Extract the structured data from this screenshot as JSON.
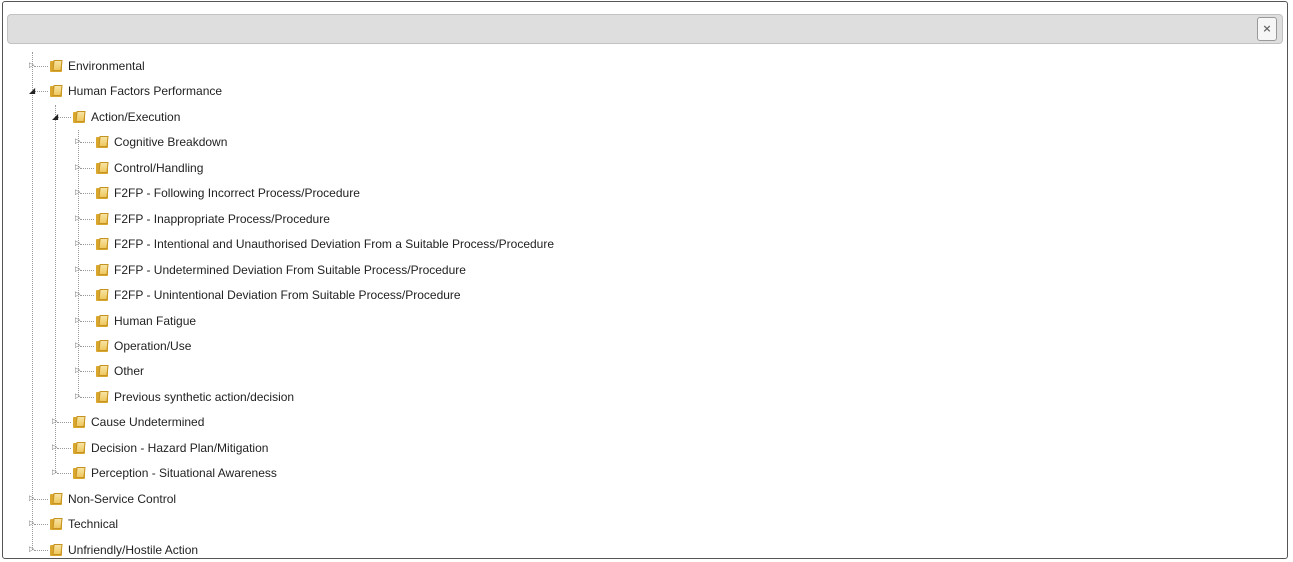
{
  "dialog": {
    "close_glyph": "×"
  },
  "tree": [
    {
      "label": "Environmental",
      "level": 0,
      "expanded": false
    },
    {
      "label": "Human Factors Performance",
      "level": 0,
      "expanded": true
    },
    {
      "label": "Action/Execution",
      "level": 1,
      "expanded": true
    },
    {
      "label": "Cognitive Breakdown",
      "level": 2,
      "expanded": false
    },
    {
      "label": "Control/Handling",
      "level": 2,
      "expanded": false
    },
    {
      "label": "F2FP - Following Incorrect Process/Procedure",
      "level": 2,
      "expanded": false
    },
    {
      "label": "F2FP - Inappropriate Process/Procedure",
      "level": 2,
      "expanded": false
    },
    {
      "label": "F2FP - Intentional and Unauthorised Deviation From a Suitable Process/Procedure",
      "level": 2,
      "expanded": false
    },
    {
      "label": "F2FP - Undetermined Deviation From Suitable Process/Procedure",
      "level": 2,
      "expanded": false
    },
    {
      "label": "F2FP - Unintentional Deviation From Suitable Process/Procedure",
      "level": 2,
      "expanded": false
    },
    {
      "label": "Human Fatigue",
      "level": 2,
      "expanded": false
    },
    {
      "label": "Operation/Use",
      "level": 2,
      "expanded": false
    },
    {
      "label": "Other",
      "level": 2,
      "expanded": false
    },
    {
      "label": "Previous synthetic action/decision",
      "level": 2,
      "expanded": false
    },
    {
      "label": "Cause Undetermined",
      "level": 1,
      "expanded": false
    },
    {
      "label": "Decision - Hazard Plan/Mitigation",
      "level": 1,
      "expanded": false
    },
    {
      "label": "Perception - Situational Awareness",
      "level": 1,
      "expanded": false
    },
    {
      "label": "Non-Service Control",
      "level": 0,
      "expanded": false
    },
    {
      "label": "Technical",
      "level": 0,
      "expanded": false
    },
    {
      "label": "Unfriendly/Hostile Action",
      "level": 0,
      "expanded": false
    }
  ],
  "icons": {
    "folder": "folder-icon",
    "expander_closed": "triangle-right-icon",
    "expander_open": "triangle-down-icon",
    "close": "close-icon"
  }
}
